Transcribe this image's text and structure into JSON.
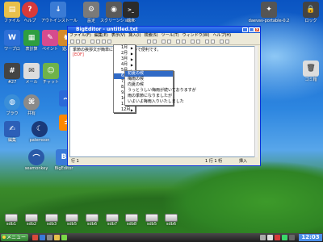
{
  "top_icons": [
    {
      "label": "ファイル",
      "icon": "folder-icon",
      "color": "#e8c04a"
    },
    {
      "label": "ヘルプ",
      "icon": "help-icon",
      "color": "#d83a3a"
    },
    {
      "label": "アウトインストール",
      "icon": "install-icon",
      "color": "#3a7bd5"
    },
    {
      "label": "設定",
      "icon": "settings-icon",
      "color": "#7a7a7a"
    },
    {
      "label": "スクリーンショット",
      "icon": "camera-icon",
      "color": "#5a5a5a"
    },
    {
      "label": "端末",
      "icon": "terminal-icon",
      "color": "#2b2b2b"
    },
    {
      "label": "daevav-portable-0.2",
      "icon": "gear-app-icon",
      "color": "#555555"
    },
    {
      "label": "ロック",
      "icon": "lock-icon",
      "color": "#444444"
    }
  ],
  "left_icons": [
    {
      "label": "ワープロ",
      "icon": "wordprocessor-icon",
      "color": "#2d6fd6"
    },
    {
      "label": "表計算",
      "icon": "spreadsheet-icon",
      "color": "#2e9e40"
    },
    {
      "label": "ペイント",
      "icon": "paint-icon",
      "color": "#d64b8e"
    },
    {
      "label": "遊ぶ",
      "icon": "game-icon",
      "color": "#d48a2a"
    },
    {
      "label": "#27",
      "icon": "tag-icon",
      "color": "#444444"
    },
    {
      "label": "メール",
      "icon": "mail-icon",
      "color": "#dddddd"
    },
    {
      "label": "チャット",
      "icon": "chat-icon",
      "color": "#6fb34a"
    },
    {
      "label": "ブラウ",
      "icon": "browser-icon",
      "color": "#3a8ed8"
    },
    {
      "label": "共有",
      "icon": "share-icon",
      "color": "#8a8a8a"
    },
    {
      "label": "",
      "icon": "wave-icon",
      "color": "#2a6ad8"
    },
    {
      "label": "",
      "icon": "calc-icon",
      "color": "#ff8800"
    },
    {
      "label": "編集",
      "icon": "editor-icon",
      "color": "#e8e8e8"
    },
    {
      "label": "palemoon",
      "icon": "palemoon-icon",
      "color": "#1a3a7a"
    },
    {
      "label": "seamonkey",
      "icon": "seamonkey-icon",
      "color": "#2a5aa8"
    },
    {
      "label": "BigEditor",
      "icon": "bigeditor-icon",
      "color": "#3a7ad8"
    }
  ],
  "right_icons": [
    {
      "label": "ゴミ箱",
      "icon": "trash-icon",
      "color": "#dddddd"
    }
  ],
  "drives": [
    "sdb1",
    "sdb2",
    "sdb3",
    "sdb5",
    "sdb6",
    "sdb7",
    "sdb8",
    "sdb5",
    "sdb6"
  ],
  "window": {
    "title": "BigEditor - untitled.txt",
    "menus": [
      "ファイル(F)",
      "編集(E)",
      "表示(V)",
      "挿入(I)",
      "検索(S)",
      "ツール(T)",
      "ウィンドウ(W)",
      "ヘルプ(H)"
    ],
    "editor_text": "季節の挨拶文が簡単に入力できるので便利です。",
    "eof": "[EOF]",
    "status": [
      "行 1",
      "1 行  1 桁",
      "挿入"
    ]
  },
  "submenu_months": [
    "1月",
    "2月",
    "3月",
    "4月",
    "5月",
    "6月",
    "7月",
    "8月",
    "9月",
    "10月",
    "11月",
    "12月"
  ],
  "highlighted_month_index": 5,
  "submenu_phrases": [
    "初夏の候",
    "梅雨の候",
    "向夏の候",
    "うっとうしい梅雨が続いておりますが",
    "雨の季節になりましたが",
    "いよいよ梅雨入りいたしました"
  ],
  "taskbar": {
    "start_label": "メニュー",
    "clock": "12:03"
  }
}
